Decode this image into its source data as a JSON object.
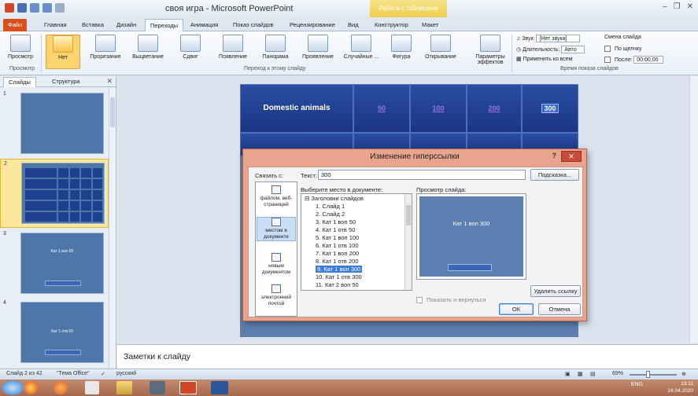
{
  "window": {
    "title": "своя игра - Microsoft PowerPoint",
    "contextual_tab_group": "Работа с таблицами"
  },
  "tabs": [
    "Файл",
    "Главная",
    "Вставка",
    "Дизайн",
    "Переходы",
    "Анимация",
    "Показ слайдов",
    "Рецензирование",
    "Вид",
    "Конструктор",
    "Макет"
  ],
  "ribbon": {
    "preview_label": "Просмотр",
    "preview_group": "Просмотр",
    "transitions": [
      "Нет",
      "Прорезание",
      "Выцветание",
      "Сдвиг",
      "Появление",
      "Панорама",
      "Проявление",
      "Случайные ...",
      "Фигура",
      "Открывание"
    ],
    "effects_label": "Параметры эффектов",
    "transition_group": "Переход к этому слайду",
    "sound_label": "Звук:",
    "sound_value": "[Нет звука]",
    "duration_label": "Длительность:",
    "duration_value": "Авто",
    "apply_all_label": "Применить ко всем",
    "advance_label": "Смена слайда",
    "on_click_label": "По щелчку",
    "after_label": "После:",
    "after_value": "00:00,00",
    "timing_group": "Время показа слайдов"
  },
  "left_pane": {
    "tab_slides": "Слайды",
    "tab_outline": "Структура",
    "thumbs": [
      {
        "num": "1",
        "text": ""
      },
      {
        "num": "2",
        "text": ""
      },
      {
        "num": "3",
        "text": "Кат 1 воп 50"
      },
      {
        "num": "4",
        "text": "Кат 1 отв 50"
      }
    ]
  },
  "slide": {
    "category": "Domestic animals",
    "values": [
      "50",
      "100",
      "200",
      "300"
    ]
  },
  "notes_placeholder": "Заметки к слайду",
  "status": {
    "slide_counter": "Слайд 2 из 42",
    "theme": "\"Тема Office\"",
    "language": "русский",
    "zoom": "69%"
  },
  "taskbar": {
    "lang": "ENG",
    "time": "13:11",
    "date": "24.04.2020"
  },
  "dialog": {
    "title": "Изменение гиперссылки",
    "link_to_label": "Связать с:",
    "text_label": "Текст:",
    "text_value": "300",
    "tooltip_button": "Подсказка...",
    "place_label": "Выберите место в документе:",
    "preview_label": "Просмотр слайда:",
    "link_types": [
      "файлом, веб-страницей",
      "местом в документе",
      "новым документом",
      "электронной почтой"
    ],
    "tree_root": "Заголовки слайдов",
    "tree_items": [
      "1. Слайд 1",
      "2. Слайд 2",
      "3. Кат 1 воп 50",
      "4. Кат 1 отв 50",
      "5. Кат 1 воп 100",
      "6. Кат 1 отв 100",
      "7. Кат 1 воп 200",
      "8. Кат 1 отв 200",
      "9. Кат 1 воп 300",
      "10. Кат 1 отв 300",
      "11. Кат 2 воп 50"
    ],
    "selected_item": "9. Кат 1 воп 300",
    "preview_slide_text": "Кат 1 воп 300",
    "show_return_label": "Показать и вернуться",
    "remove_link_button": "Удалить ссылку",
    "ok_button": "ОК",
    "cancel_button": "Отмена"
  }
}
